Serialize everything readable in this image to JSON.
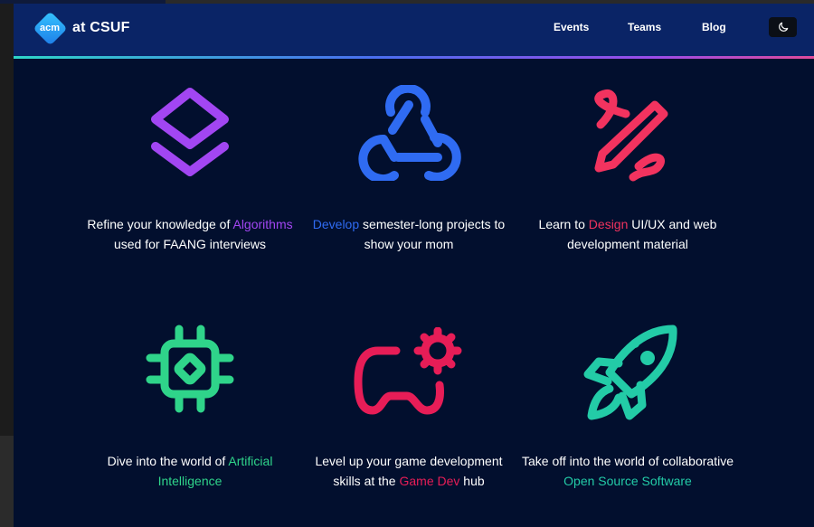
{
  "navbar": {
    "logo_badge": "acm",
    "logo_text": "at CSUF",
    "links": [
      "Events",
      "Teams",
      "Blog"
    ],
    "theme_icon": "moon-icon"
  },
  "cards": [
    {
      "icon": "layers-icon",
      "color": "#a246f2",
      "pre": "Refine your knowledge of",
      "highlight": "Algorithms",
      "post": "used for FAANG interviews"
    },
    {
      "icon": "webhook-icon",
      "color": "#2f6bf2",
      "pre": "",
      "highlight": "Develop",
      "post": "semester-long projects to show your mom"
    },
    {
      "icon": "pencil-icon",
      "color": "#f2335f",
      "pre": "Learn to",
      "highlight": "Design",
      "post": "UI/UX and web development material"
    },
    {
      "icon": "chip-icon",
      "color": "#2fd48a",
      "pre": "Dive into the world of",
      "highlight": "Artificial Intelligence",
      "post": ""
    },
    {
      "icon": "gamepad-gear-icon",
      "color": "#e71d57",
      "pre": "Level up your game development skills at the",
      "highlight": "Game Dev",
      "post": "hub"
    },
    {
      "icon": "rocket-icon",
      "color": "#23cba7",
      "pre": "Take off into the world of collaborative",
      "highlight": "Open Source Software",
      "post": ""
    }
  ]
}
